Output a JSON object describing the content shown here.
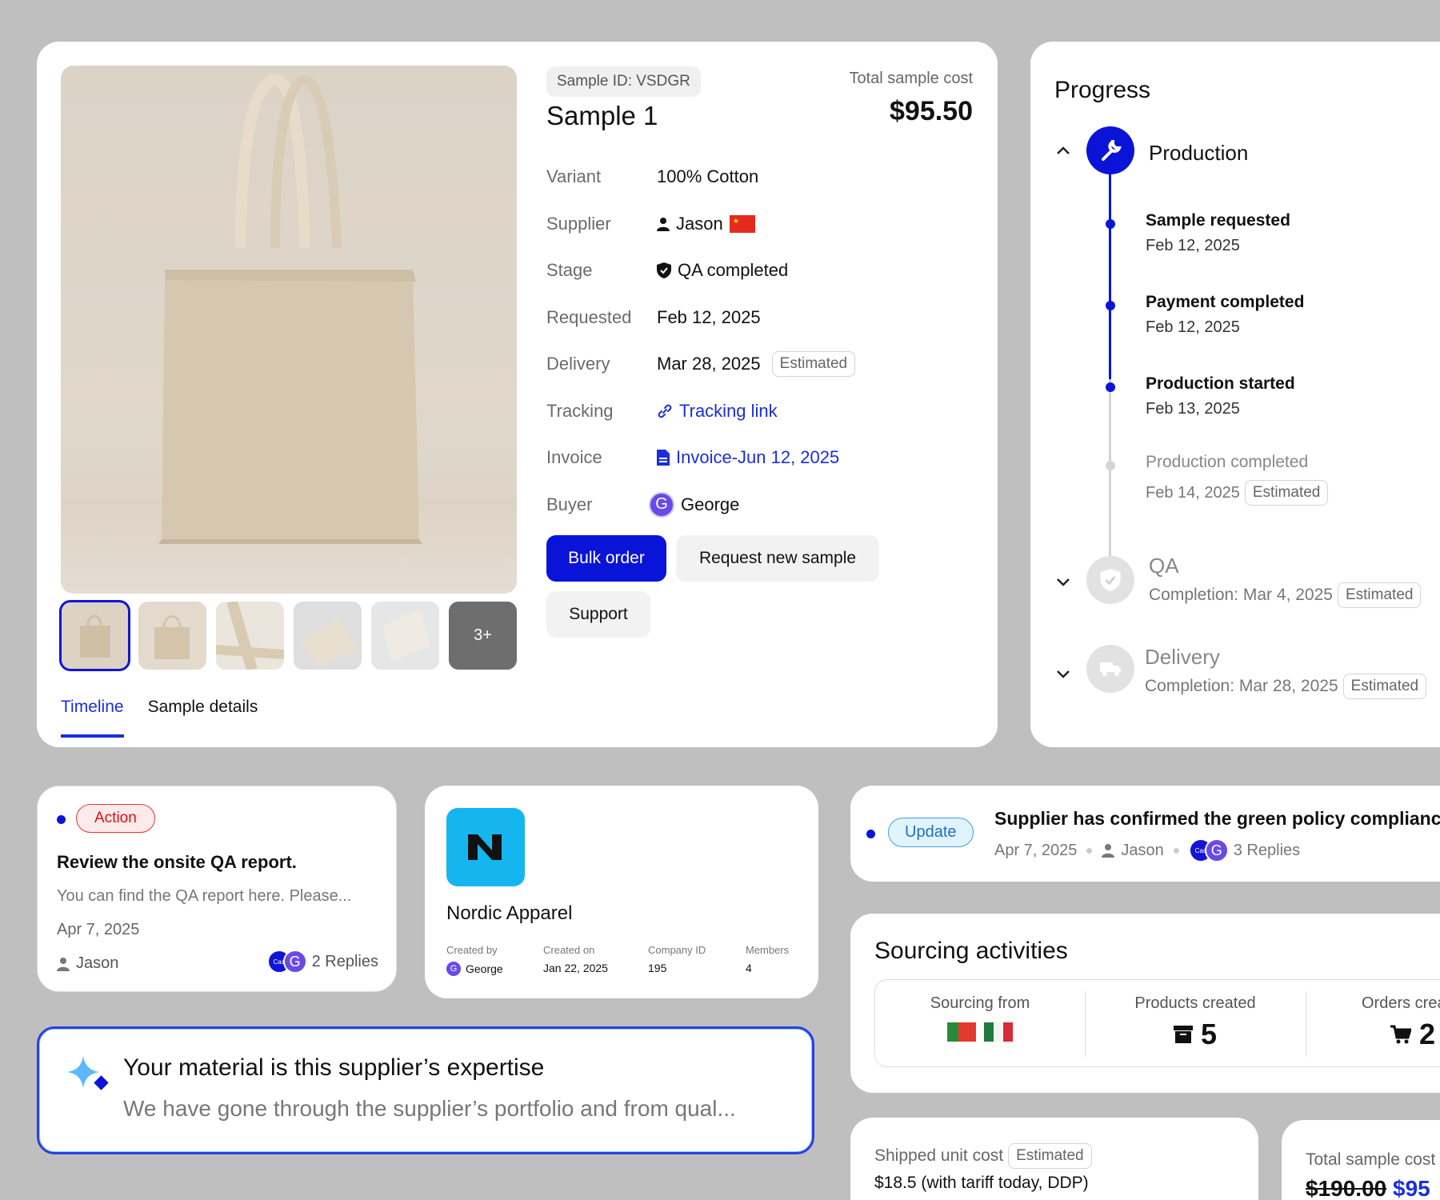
{
  "sample": {
    "id_chip": "Sample ID: VSDGR",
    "title": "Sample 1",
    "cost_label": "Total sample cost",
    "cost_value": "$95.50",
    "thumbs_more": "3+",
    "rows": [
      {
        "label": "Variant",
        "value": "100% Cotton"
      },
      {
        "label": "Supplier",
        "value": "Jason"
      },
      {
        "label": "Stage",
        "value": "QA completed"
      },
      {
        "label": "Requested",
        "value": "Feb 12, 2025"
      },
      {
        "label": "Delivery",
        "value": "Mar 28, 2025",
        "chip": "Estimated"
      },
      {
        "label": "Tracking",
        "value": "Tracking link"
      },
      {
        "label": "Invoice",
        "value": "Invoice-Jun 12, 2025"
      },
      {
        "label": "Buyer",
        "value": "George",
        "avatar": "G"
      }
    ],
    "buttons": {
      "bulk": "Bulk order",
      "request": "Request new sample",
      "support": "Support"
    },
    "tabs": {
      "timeline": "Timeline",
      "details": "Sample details"
    }
  },
  "progress": {
    "title": "Progress",
    "production": {
      "label": "Production",
      "steps": [
        {
          "title": "Sample requested",
          "date": "Feb 12, 2025"
        },
        {
          "title": "Payment completed",
          "date": "Feb 12, 2025"
        },
        {
          "title": "Production started",
          "date": "Feb 13, 2025"
        },
        {
          "title": "Production completed",
          "date": "Feb 14, 2025",
          "chip": "Estimated"
        }
      ]
    },
    "qa": {
      "label": "QA",
      "completion": "Completion: Mar 4, 2025",
      "chip": "Estimated"
    },
    "delivery": {
      "label": "Delivery",
      "completion": "Completion: Mar 28, 2025",
      "chip": "Estimated"
    }
  },
  "action": {
    "badge": "Action",
    "title": "Review the onsite QA report.",
    "body": "You can find the QA report here. Please...",
    "date": "Apr 7, 2025",
    "author": "Jason",
    "replies": "2 Replies",
    "avatar_a": "Cas",
    "avatar_b": "G"
  },
  "company": {
    "name": "Nordic Apparel",
    "fields": [
      {
        "label": "Created by",
        "value": "George",
        "avatar": "G"
      },
      {
        "label": "Created on",
        "value": "Jan 22, 2025"
      },
      {
        "label": "Company ID",
        "value": "195"
      },
      {
        "label": "Members",
        "value": "4"
      }
    ]
  },
  "insight": {
    "title": "Your material is this supplier’s expertise",
    "body": "We have gone through the supplier’s portfolio and from qual..."
  },
  "update": {
    "badge": "Update",
    "title": "Supplier has confirmed the green policy compliance",
    "date": "Apr 7, 2025",
    "author": "Jason",
    "replies": "3 Replies",
    "avatar_a": "Cas",
    "avatar_b": "G"
  },
  "sourcing": {
    "title": "Sourcing activities",
    "from_label": "Sourcing from",
    "products_label": "Products created",
    "products_value": "5",
    "orders_label": "Orders crea",
    "orders_value": "2"
  },
  "unit_cost": {
    "label": "Shipped unit cost",
    "chip": "Estimated",
    "value": "$18.5 (with tariff today, DDP)"
  },
  "total_cost": {
    "label": "Total sample cost",
    "old": "$190.00",
    "new": "$95"
  },
  "colors": {
    "accent": "#0a14d9",
    "action_red": "#dd1111",
    "update_blue": "#1d72c0",
    "company_logo": "#15b6ef"
  }
}
